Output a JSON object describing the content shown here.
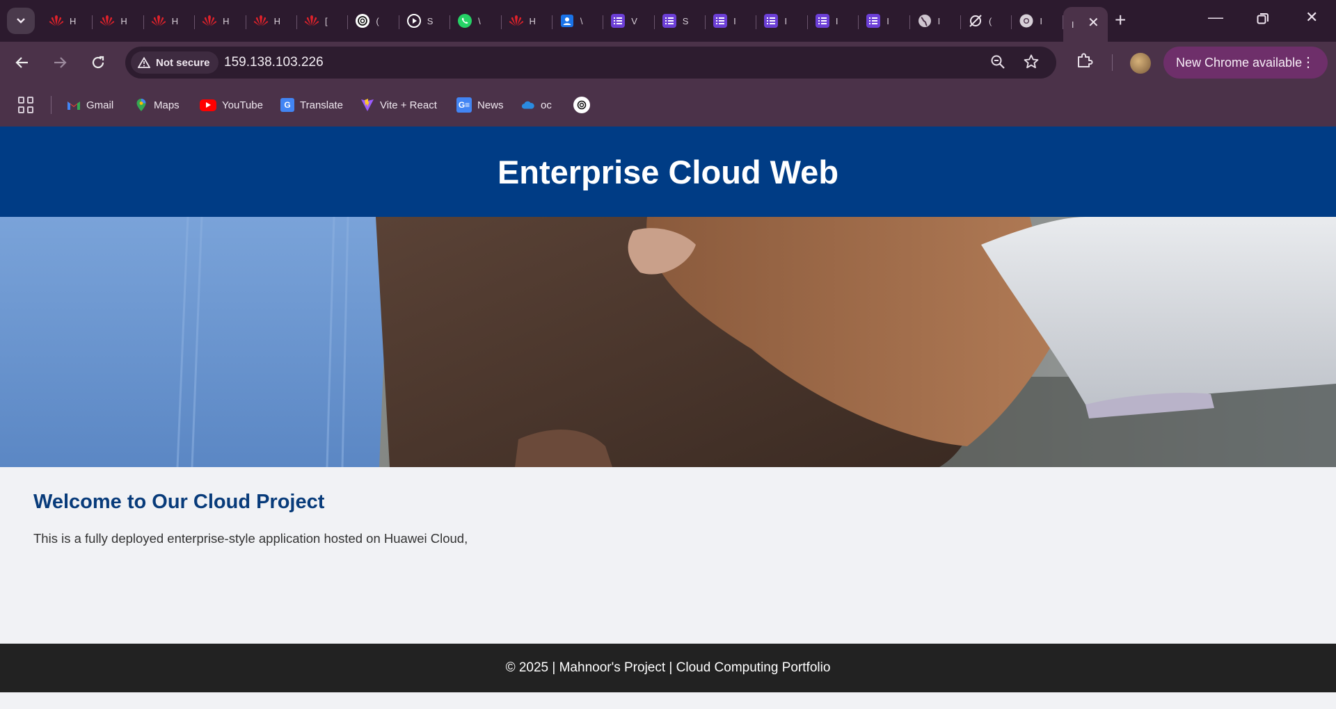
{
  "browser": {
    "tabs": [
      {
        "icon": "huawei-icon",
        "title": "H"
      },
      {
        "icon": "huawei-icon",
        "title": "H"
      },
      {
        "icon": "huawei-icon",
        "title": "H"
      },
      {
        "icon": "huawei-icon",
        "title": "H"
      },
      {
        "icon": "huawei-icon",
        "title": "H"
      },
      {
        "icon": "huawei-icon",
        "title": "["
      },
      {
        "icon": "chatgpt-icon",
        "title": "("
      },
      {
        "icon": "play-icon",
        "title": "S"
      },
      {
        "icon": "whatsapp-icon",
        "title": "\\"
      },
      {
        "icon": "huawei-icon",
        "title": "H"
      },
      {
        "icon": "contacts-icon",
        "title": "\\"
      },
      {
        "icon": "list-icon",
        "title": "V"
      },
      {
        "icon": "list-icon",
        "title": "S"
      },
      {
        "icon": "list-icon",
        "title": "I"
      },
      {
        "icon": "list-icon",
        "title": "I"
      },
      {
        "icon": "list-icon",
        "title": "I"
      },
      {
        "icon": "list-icon",
        "title": "I"
      },
      {
        "icon": "globe-icon",
        "title": "I"
      },
      {
        "icon": "no-signal-icon",
        "title": "("
      },
      {
        "icon": "chrome-icon",
        "title": "I"
      }
    ],
    "active_tab_title": "I",
    "security_label": "Not secure",
    "url": "159.138.103.226",
    "update_label": "New Chrome available",
    "bookmarks": [
      {
        "label": "Gmail",
        "icon": "gmail-icon",
        "color": "#ea4335"
      },
      {
        "label": "Maps",
        "icon": "maps-icon",
        "color": "#34a853"
      },
      {
        "label": "YouTube",
        "icon": "youtube-icon",
        "color": "#ff0000"
      },
      {
        "label": "Translate",
        "icon": "translate-icon",
        "color": "#4285f4"
      },
      {
        "label": "Vite + React",
        "icon": "vite-icon",
        "color": "#9b5cff"
      },
      {
        "label": "News",
        "icon": "news-icon",
        "color": "#4285f4"
      },
      {
        "label": "oc",
        "icon": "onedrive-icon",
        "color": "#2a8be0"
      },
      {
        "label": "",
        "icon": "chatgpt-icon",
        "color": "#ffffff"
      }
    ]
  },
  "page": {
    "header_title": "Enterprise Cloud Web",
    "hero_image": "handshake-photo",
    "welcome_heading": "Welcome to Our Cloud Project",
    "welcome_text": "This is a fully deployed enterprise-style application hosted on Huawei Cloud,",
    "footer_text": "© 2025 | Mahnoor's Project | Cloud Computing Portfolio",
    "colors": {
      "header_bg": "#003c85",
      "heading": "#083b7a",
      "footer_bg": "#222222",
      "browser_frame": "#4b3249"
    }
  }
}
